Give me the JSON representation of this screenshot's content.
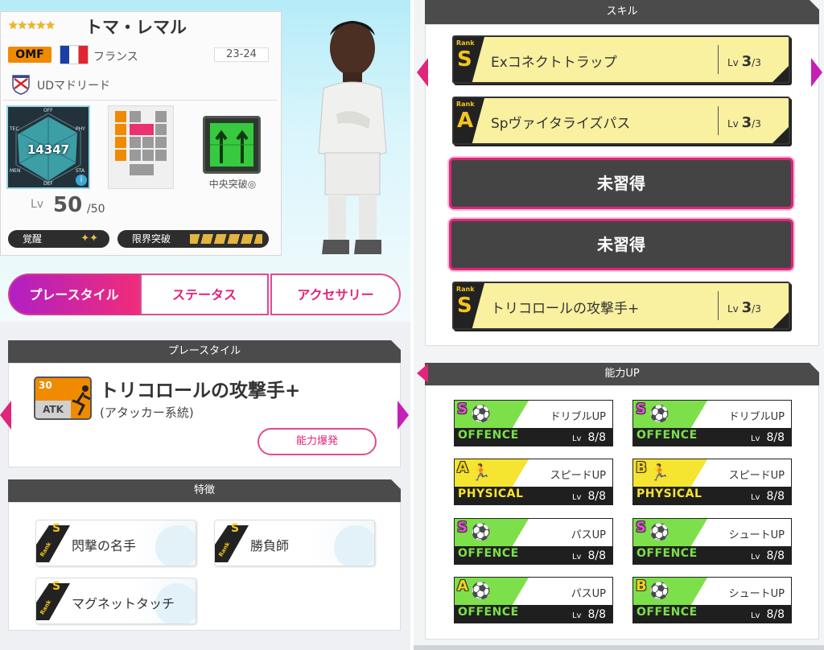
{
  "player": {
    "stars": "★★★★★",
    "name": "トマ・レマル",
    "position": "OMF",
    "nation": "フランス",
    "season": "23-24",
    "club": "UDマドリード",
    "total": "14347",
    "radar_labels": [
      "OFF",
      "TEC",
      "PHY",
      "MEN",
      "STA",
      "DEF"
    ],
    "tactic": "中央突破◎",
    "lv_label": "Lv",
    "lv_current": "50",
    "lv_max": "/50",
    "awaken_label": "覚醒",
    "awaken_marks": "✦✦",
    "limit_label": "限界突破"
  },
  "tabs": [
    {
      "label": "プレースタイル",
      "active": true
    },
    {
      "label": "ステータス",
      "active": false
    },
    {
      "label": "アクセサリー",
      "active": false
    }
  ],
  "playstyle": {
    "header": "プレースタイル",
    "icon_num": "30",
    "icon_code": "ATK",
    "title": "トリコロールの攻撃手+",
    "subtitle": "(アタッカー系統)",
    "button": "能力爆発"
  },
  "traits": {
    "header": "特徴",
    "rank_label": "Rank",
    "rank_letter": "S",
    "items": [
      "閃撃の名手",
      "勝負師",
      "マグネットタッチ"
    ]
  },
  "skills": {
    "header": "スキル",
    "rank_label": "Rank",
    "lv_label": "Lv",
    "items": [
      {
        "rank": "S",
        "name": "Exコネクトトラップ",
        "lv": "3",
        "max": "/3"
      },
      {
        "rank": "A",
        "name": "Spヴァイタライズパス",
        "lv": "3",
        "max": "/3"
      },
      {
        "locked": "未習得"
      },
      {
        "locked": "未習得"
      },
      {
        "rank": "S",
        "name": "トリコロールの攻撃手+",
        "lv": "3",
        "max": "/3"
      }
    ]
  },
  "abilities": {
    "header": "能力UP",
    "lv_label": "Lv",
    "items": [
      {
        "rank": "S",
        "name": "ドリブルUP",
        "cat": "OFFENCE",
        "lv": "8/8"
      },
      {
        "rank": "S",
        "name": "ドリブルUP",
        "cat": "OFFENCE",
        "lv": "8/8"
      },
      {
        "rank": "A",
        "name": "スピードUP",
        "cat": "PHYSICAL",
        "lv": "8/8"
      },
      {
        "rank": "B",
        "name": "スピードUP",
        "cat": "PHYSICAL",
        "lv": "8/8"
      },
      {
        "rank": "S",
        "name": "パスUP",
        "cat": "OFFENCE",
        "lv": "8/8"
      },
      {
        "rank": "S",
        "name": "シュートUP",
        "cat": "OFFENCE",
        "lv": "8/8"
      },
      {
        "rank": "A",
        "name": "パスUP",
        "cat": "OFFENCE",
        "lv": "8/8"
      },
      {
        "rank": "B",
        "name": "シュートUP",
        "cat": "OFFENCE",
        "lv": "8/8"
      }
    ]
  },
  "colors": {
    "accent": "#e0257a",
    "offence_band": "#7de04a",
    "physical_band": "#f5e430",
    "rank_s": "#e34fd0",
    "rank_a": "#f2d21a",
    "rank_b": "#f2d21a"
  }
}
